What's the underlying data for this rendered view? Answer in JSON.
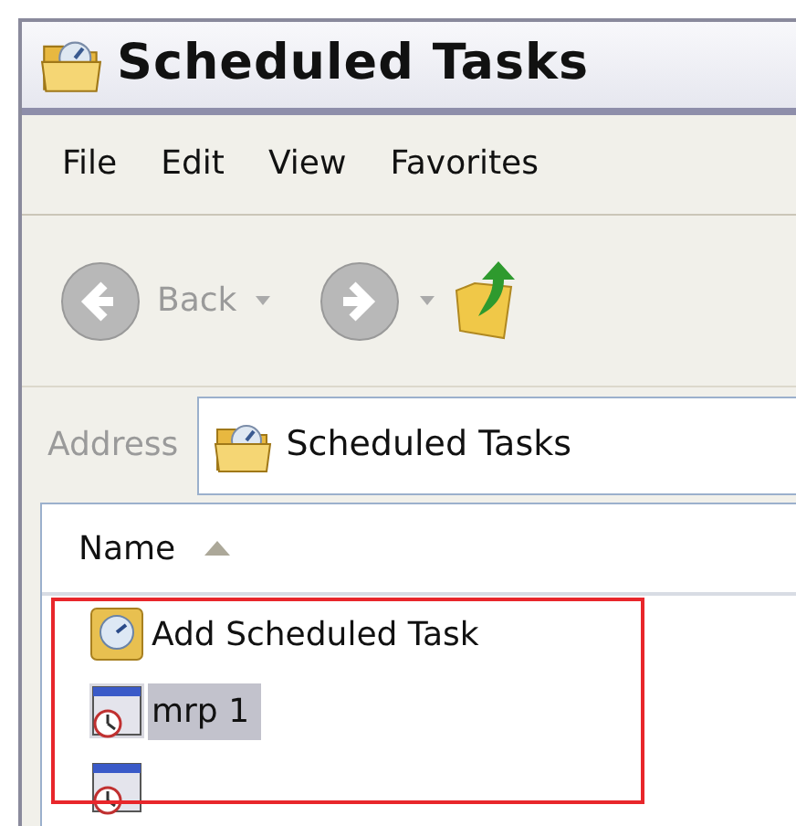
{
  "window": {
    "title": "Scheduled Tasks"
  },
  "menu": [
    "File",
    "Edit",
    "View",
    "Favorites"
  ],
  "toolbar": {
    "back": {
      "label": "Back",
      "disabled": true
    },
    "forward": {
      "disabled": true
    }
  },
  "address": {
    "label": "Address",
    "value": "Scheduled Tasks"
  },
  "list": {
    "columns": [
      {
        "label": "Name",
        "sorted_ascending": true
      }
    ],
    "items": [
      {
        "kind": "wizard",
        "name": "Add Scheduled Task",
        "selected": false
      },
      {
        "kind": "task",
        "name": "mrp 1",
        "selected": true
      },
      {
        "kind": "task",
        "selected": false
      }
    ]
  },
  "annotations": [
    {
      "kind": "frame",
      "color": "#e8262b"
    }
  ]
}
